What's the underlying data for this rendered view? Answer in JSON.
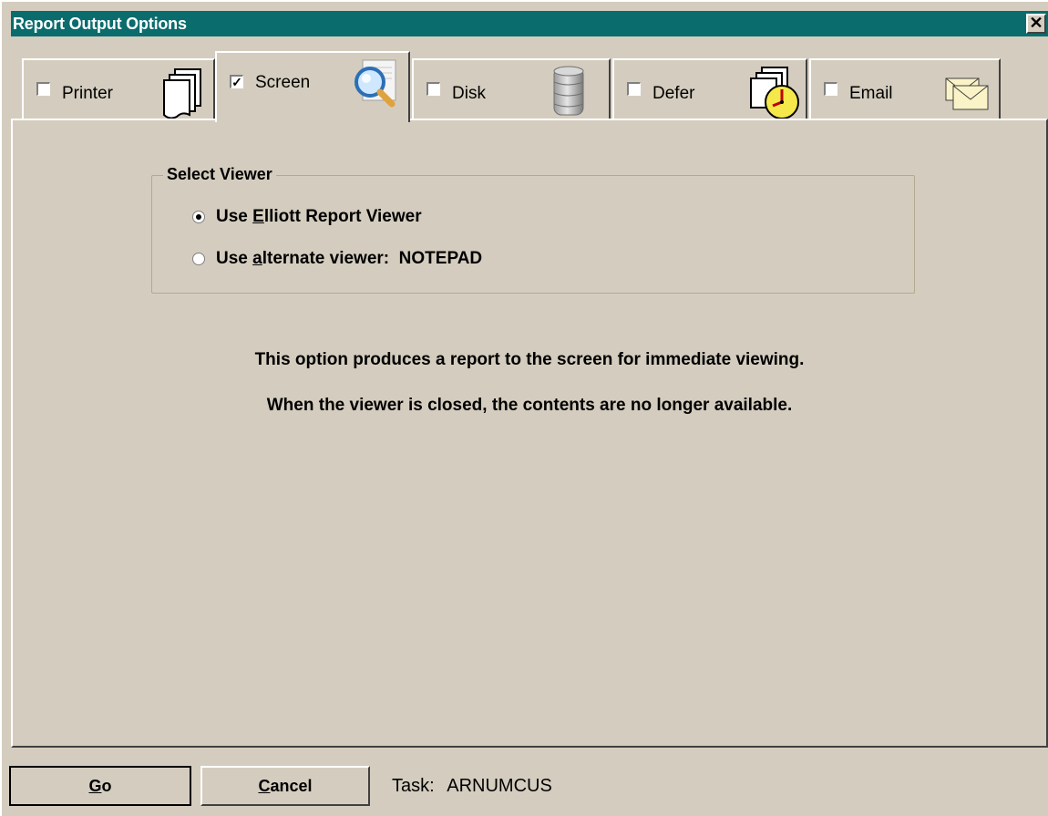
{
  "window": {
    "title": "Report Output Options",
    "close_glyph": "✕"
  },
  "tabs": [
    {
      "label": "Printer",
      "checked": false,
      "icon": "printer-icon"
    },
    {
      "label": "Screen",
      "checked": true,
      "icon": "magnifier-icon"
    },
    {
      "label": "Disk",
      "checked": false,
      "icon": "disk-stack-icon"
    },
    {
      "label": "Defer",
      "checked": false,
      "icon": "clock-icon"
    },
    {
      "label": "Email",
      "checked": false,
      "icon": "envelope-icon"
    }
  ],
  "viewer_group": {
    "legend": "Select Viewer",
    "options": [
      {
        "prefix": "Use ",
        "accel": "E",
        "suffix": "lliott Report Viewer",
        "selected": true
      },
      {
        "prefix": "Use ",
        "accel": "a",
        "suffix": "lternate viewer:  NOTEPAD",
        "selected": false
      }
    ]
  },
  "description": {
    "line1": "This option produces a report to the screen for immediate viewing.",
    "line2": "When the viewer is closed, the contents are no longer available."
  },
  "buttons": {
    "go": {
      "accel": "G",
      "rest": "o"
    },
    "cancel": {
      "accel": "C",
      "rest": "ancel"
    }
  },
  "task": {
    "label": "Task:",
    "value": "ARNUMCUS"
  },
  "colors": {
    "title_bar": "#0a6c6c",
    "dialog_bg": "#d4cdbf"
  }
}
